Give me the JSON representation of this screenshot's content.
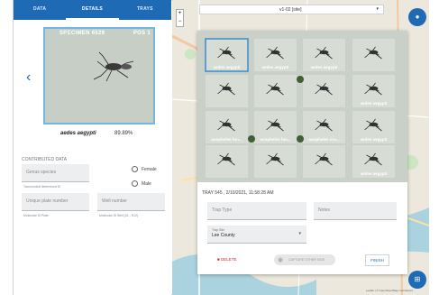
{
  "tabs": [
    {
      "label": "DATA"
    },
    {
      "label": "DETAILS"
    },
    {
      "label": "TRAYS"
    }
  ],
  "specimen": {
    "title": "SPECIMEN 6529",
    "position": "POS 1",
    "species": "aedes aegypti",
    "confidence": "89.89%"
  },
  "contributed": {
    "heading": "CONTRIBUTED DATA",
    "genus_placeholder": "Genus species",
    "genus_hint": "Taxonomical determined ID",
    "female_label": "Female",
    "male_label": "Male",
    "plate_placeholder": "Unique plate number",
    "plate_hint": "Molecular ID Plate",
    "well_placeholder": "Well number",
    "well_hint": "Molecular ID Well (A1 - H12)"
  },
  "map": {
    "layer_select": "v1-02 [site]",
    "attribution": "Leaflet | © OpenStreetMap contributors"
  },
  "tray_cells": [
    {
      "label": "aedes aegypti"
    },
    {
      "label": "aedes aegypti"
    },
    {
      "label": "aedes aegypti"
    },
    {
      "label": ""
    },
    {
      "label": ""
    },
    {
      "label": ""
    },
    {
      "label": ""
    },
    {
      "label": "aedes aegypti"
    },
    {
      "label": "anopheles fun..."
    },
    {
      "label": "anopheles fun..."
    },
    {
      "label": "anopheles cru..."
    },
    {
      "label": "aedes aegypti"
    },
    {
      "label": ""
    },
    {
      "label": ""
    },
    {
      "label": ""
    },
    {
      "label": "aedes aegypti"
    }
  ],
  "tray": {
    "meta": "TRAY 545 , 2/10/2021, 11:58:28 AM",
    "trap_type_placeholder": "Trap Type",
    "notes_placeholder": "Notes",
    "trap_site_label": "Trap Site",
    "trap_site_value": "Lee County",
    "delete_label": "DELETE",
    "capture_label": "CAPTURE OTHER SIDE",
    "finish_label": "FINISH"
  }
}
